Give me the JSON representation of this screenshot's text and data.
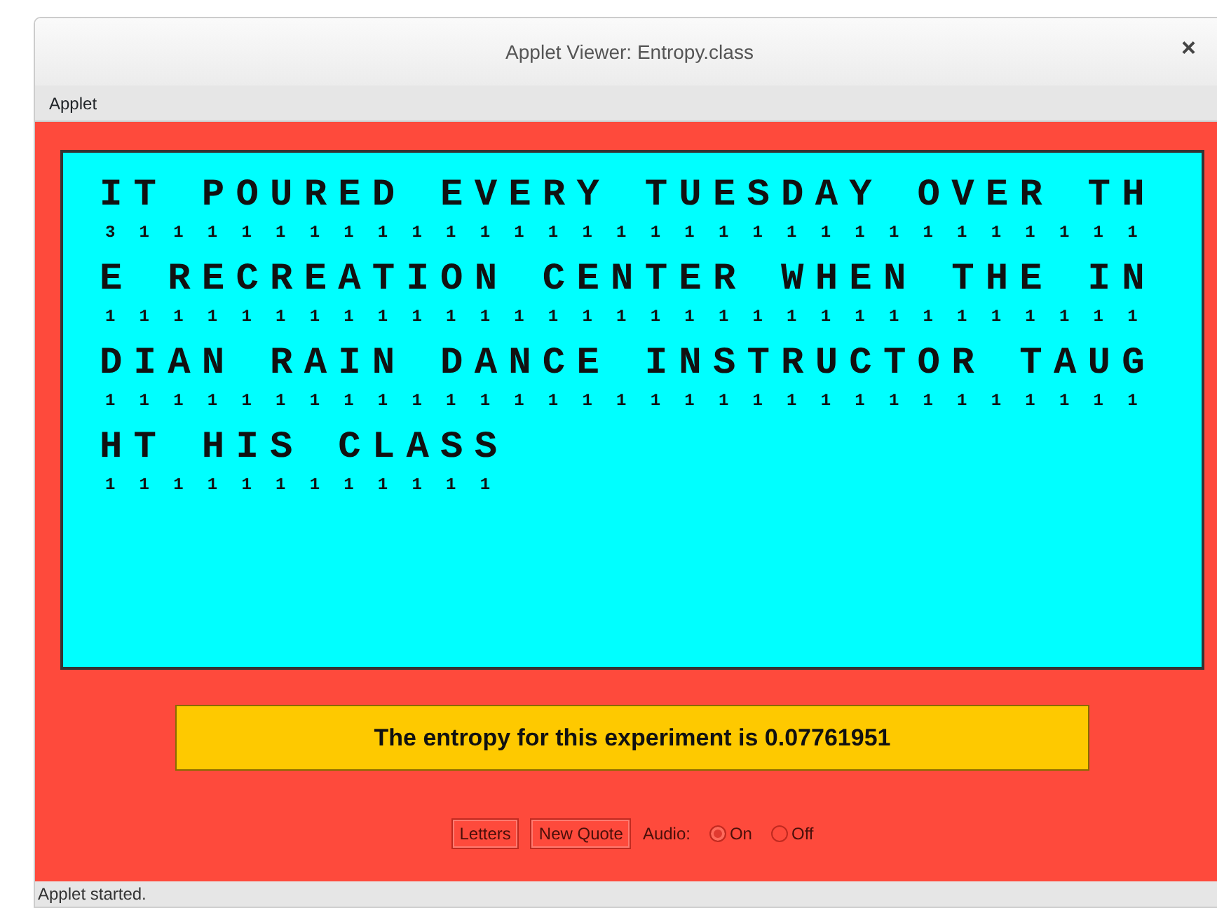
{
  "window": {
    "title": "Applet Viewer: Entropy.class",
    "close": "×"
  },
  "menu": [
    "Applet"
  ],
  "quote_lines": [
    {
      "text": "IT POURED EVERY TUESDAY OVER TH",
      "counts": "3 1 1 1 1 1 1 1 1 1 1 1 1 1 1 1 1 1 1 1 1 1 1 1 1 1 1 1 1 1 1"
    },
    {
      "text": "E RECREATION CENTER WHEN THE IN",
      "counts": "1 1 1 1 1 1 1 1 1 1 1 1 1 1 1 1 1 1 1 1 1 1 1 1 1 1 1 1 1 1 1"
    },
    {
      "text": "DIAN RAIN DANCE INSTRUCTOR TAUG",
      "counts": "1 1 1 1 1 1 1 1 1 1 1 1 1 1 1 1 1 1 1 1 1 1 1 1 1 1 1 1 1 1 1"
    },
    {
      "text": "HT HIS CLASS",
      "counts": "1 1 1 1 1 1 1 1 1 1 1 1"
    }
  ],
  "result": "The entropy for this experiment is 0.07761951",
  "buttons": [
    "Letters",
    "New Quote"
  ],
  "audio": {
    "label": "Audio:",
    "options": [
      {
        "label": "On",
        "selected": true
      },
      {
        "label": "Off",
        "selected": false
      }
    ]
  },
  "status_bar": "Applet started."
}
